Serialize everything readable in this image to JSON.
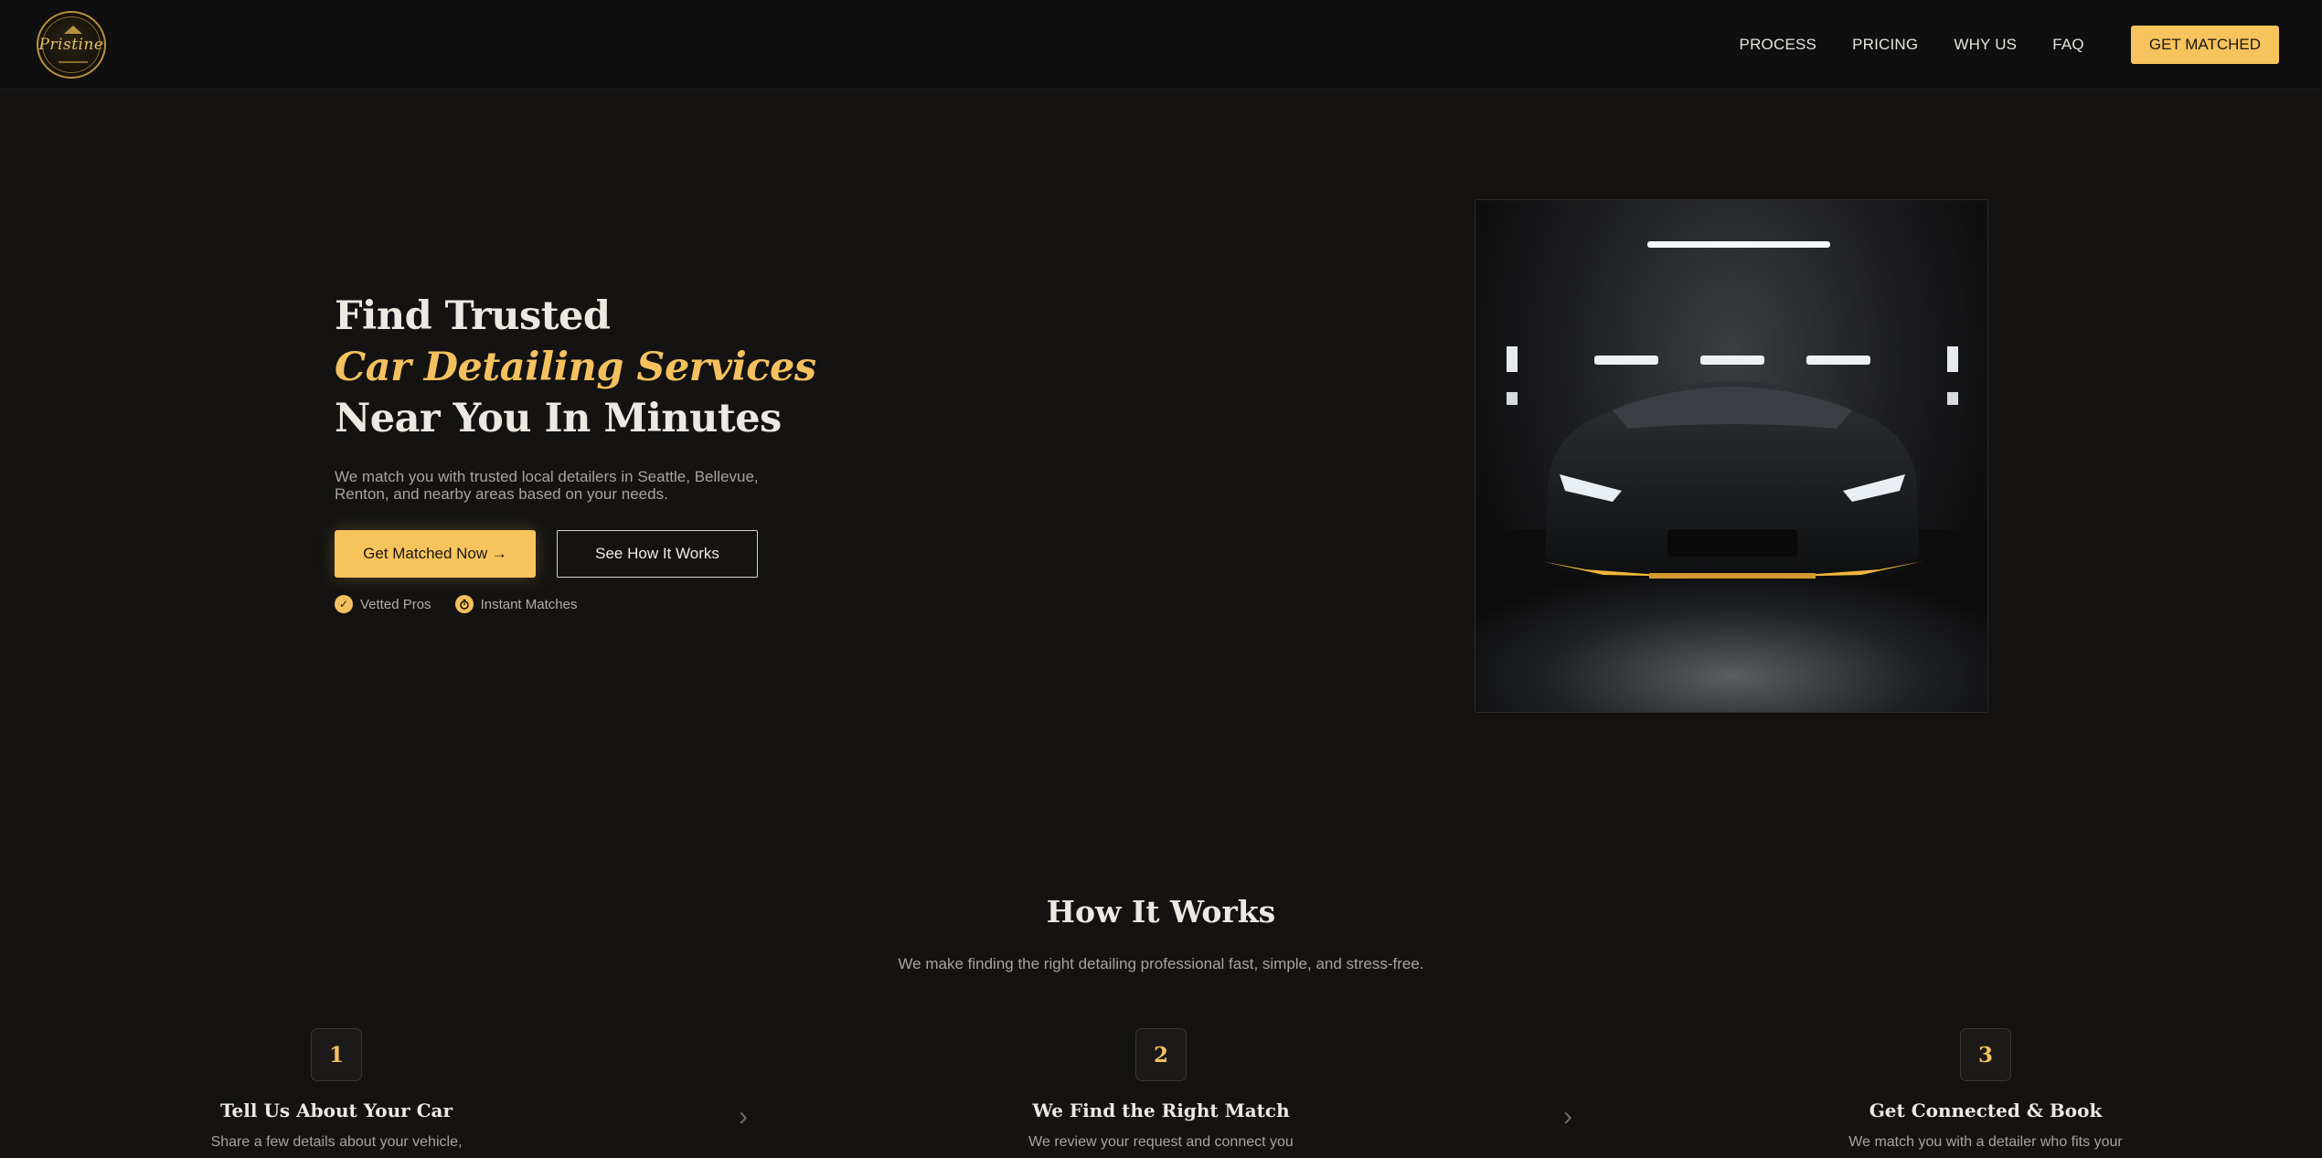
{
  "header": {
    "logo_text": "Pristine",
    "nav": [
      "PROCESS",
      "PRICING",
      "WHY US",
      "FAQ"
    ],
    "cta": "GET MATCHED"
  },
  "hero": {
    "title_line1": "Find Trusted",
    "title_accent": "Car Detailing Services",
    "title_line3": "Near You In Minutes",
    "subtitle": "We match you with trusted local detailers in Seattle, Bellevue, Renton, and nearby areas based on your needs.",
    "primary_button": "Get Matched Now →",
    "secondary_button": "See How It Works",
    "badges": [
      {
        "icon": "check-badge-icon",
        "label": "Vetted Pros"
      },
      {
        "icon": "stopwatch-icon",
        "label": "Instant Matches"
      }
    ]
  },
  "how_it_works": {
    "title": "How It Works",
    "subtitle": "We make finding the right detailing professional fast, simple, and stress-free.",
    "steps": [
      {
        "number": "1",
        "title": "Tell Us About Your Car",
        "desc": "Share a few details about your vehicle,"
      },
      {
        "number": "2",
        "title": "We Find the Right Match",
        "desc": "We review your request and connect you"
      },
      {
        "number": "3",
        "title": "Get Connected & Book",
        "desc": "We match you with a detailer who fits your"
      }
    ]
  },
  "colors": {
    "accent": "#f7c35c",
    "background": "#141312",
    "header_bg": "#0f0f0f"
  }
}
